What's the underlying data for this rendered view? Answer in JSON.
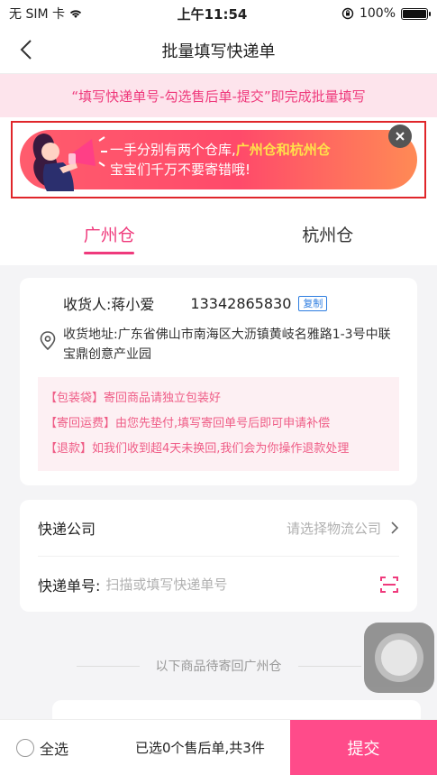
{
  "status_bar": {
    "carrier": "无 SIM 卡",
    "time": "上午11:54",
    "battery_pct": "100%"
  },
  "nav": {
    "title": "批量填写快递单"
  },
  "tip_banner": {
    "text": "“填写快递单号-勾选售后单-提交”即完成批量填写"
  },
  "promo": {
    "line1_prefix": "一手分别有两个仓库,",
    "line1_highlight": "广州仓和杭州仓",
    "line2": "宝宝们千万不要寄错哦!",
    "colors": {
      "gradient_start": "#ff5c6d",
      "gradient_end": "#ff8a55",
      "highlight": "#ffe14a"
    }
  },
  "tabs": [
    {
      "label": "广州仓",
      "active": true
    },
    {
      "label": "杭州仓",
      "active": false
    }
  ],
  "address": {
    "receiver_label": "收货人:",
    "receiver_name": "蒋小爱",
    "phone": "13342865830",
    "copy_label": "复制",
    "address_text": "收货地址:广东省佛山市南海区大沥镇黄岐名雅路1-3号中联宝鼎创意产业园"
  },
  "notices": [
    "【包装袋】寄回商品请独立包装好",
    "【寄回运费】由您先垫付,填写寄回单号后即可申请补偿",
    "【退款】如我们收到超4天未换回,我们会为你操作退款处理"
  ],
  "form": {
    "company_label": "快递公司",
    "company_placeholder": "请选择物流公司",
    "tracking_label": "快递单号:",
    "tracking_placeholder": "扫描或填写快递单号"
  },
  "divider_text": "以下商品待寄回广州仓",
  "bottom": {
    "select_all": "全选",
    "summary": "已选0个售后单,共3件",
    "submit": "提交"
  },
  "theme": {
    "accent": "#ef3a7c",
    "submit_bg": "#ff4b8a"
  }
}
